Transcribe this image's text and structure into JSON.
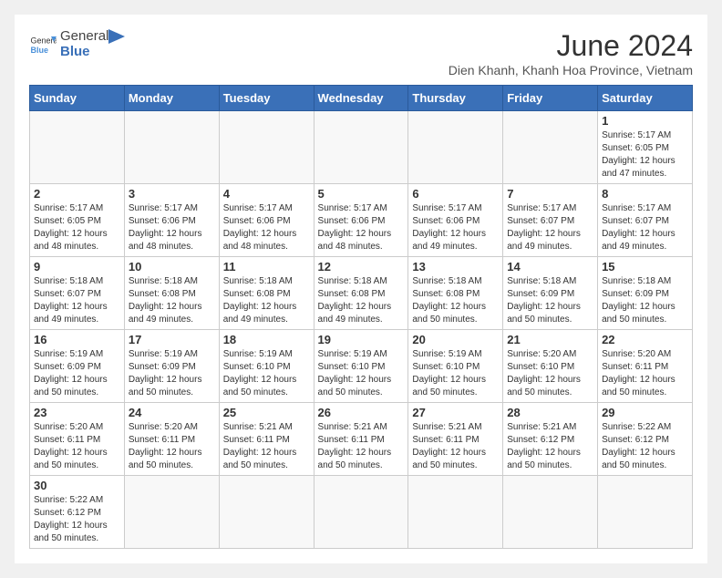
{
  "header": {
    "logo_general": "General",
    "logo_blue": "Blue",
    "month_title": "June 2024",
    "subtitle": "Dien Khanh, Khanh Hoa Province, Vietnam"
  },
  "weekdays": [
    "Sunday",
    "Monday",
    "Tuesday",
    "Wednesday",
    "Thursday",
    "Friday",
    "Saturday"
  ],
  "weeks": [
    {
      "days": [
        {
          "num": "",
          "info": ""
        },
        {
          "num": "",
          "info": ""
        },
        {
          "num": "",
          "info": ""
        },
        {
          "num": "",
          "info": ""
        },
        {
          "num": "",
          "info": ""
        },
        {
          "num": "",
          "info": ""
        },
        {
          "num": "1",
          "info": "Sunrise: 5:17 AM\nSunset: 6:05 PM\nDaylight: 12 hours and 47 minutes."
        }
      ]
    },
    {
      "days": [
        {
          "num": "2",
          "info": "Sunrise: 5:17 AM\nSunset: 6:05 PM\nDaylight: 12 hours and 48 minutes."
        },
        {
          "num": "3",
          "info": "Sunrise: 5:17 AM\nSunset: 6:06 PM\nDaylight: 12 hours and 48 minutes."
        },
        {
          "num": "4",
          "info": "Sunrise: 5:17 AM\nSunset: 6:06 PM\nDaylight: 12 hours and 48 minutes."
        },
        {
          "num": "5",
          "info": "Sunrise: 5:17 AM\nSunset: 6:06 PM\nDaylight: 12 hours and 48 minutes."
        },
        {
          "num": "6",
          "info": "Sunrise: 5:17 AM\nSunset: 6:06 PM\nDaylight: 12 hours and 49 minutes."
        },
        {
          "num": "7",
          "info": "Sunrise: 5:17 AM\nSunset: 6:07 PM\nDaylight: 12 hours and 49 minutes."
        },
        {
          "num": "8",
          "info": "Sunrise: 5:17 AM\nSunset: 6:07 PM\nDaylight: 12 hours and 49 minutes."
        }
      ]
    },
    {
      "days": [
        {
          "num": "9",
          "info": "Sunrise: 5:18 AM\nSunset: 6:07 PM\nDaylight: 12 hours and 49 minutes."
        },
        {
          "num": "10",
          "info": "Sunrise: 5:18 AM\nSunset: 6:08 PM\nDaylight: 12 hours and 49 minutes."
        },
        {
          "num": "11",
          "info": "Sunrise: 5:18 AM\nSunset: 6:08 PM\nDaylight: 12 hours and 49 minutes."
        },
        {
          "num": "12",
          "info": "Sunrise: 5:18 AM\nSunset: 6:08 PM\nDaylight: 12 hours and 49 minutes."
        },
        {
          "num": "13",
          "info": "Sunrise: 5:18 AM\nSunset: 6:08 PM\nDaylight: 12 hours and 50 minutes."
        },
        {
          "num": "14",
          "info": "Sunrise: 5:18 AM\nSunset: 6:09 PM\nDaylight: 12 hours and 50 minutes."
        },
        {
          "num": "15",
          "info": "Sunrise: 5:18 AM\nSunset: 6:09 PM\nDaylight: 12 hours and 50 minutes."
        }
      ]
    },
    {
      "days": [
        {
          "num": "16",
          "info": "Sunrise: 5:19 AM\nSunset: 6:09 PM\nDaylight: 12 hours and 50 minutes."
        },
        {
          "num": "17",
          "info": "Sunrise: 5:19 AM\nSunset: 6:09 PM\nDaylight: 12 hours and 50 minutes."
        },
        {
          "num": "18",
          "info": "Sunrise: 5:19 AM\nSunset: 6:10 PM\nDaylight: 12 hours and 50 minutes."
        },
        {
          "num": "19",
          "info": "Sunrise: 5:19 AM\nSunset: 6:10 PM\nDaylight: 12 hours and 50 minutes."
        },
        {
          "num": "20",
          "info": "Sunrise: 5:19 AM\nSunset: 6:10 PM\nDaylight: 12 hours and 50 minutes."
        },
        {
          "num": "21",
          "info": "Sunrise: 5:20 AM\nSunset: 6:10 PM\nDaylight: 12 hours and 50 minutes."
        },
        {
          "num": "22",
          "info": "Sunrise: 5:20 AM\nSunset: 6:11 PM\nDaylight: 12 hours and 50 minutes."
        }
      ]
    },
    {
      "days": [
        {
          "num": "23",
          "info": "Sunrise: 5:20 AM\nSunset: 6:11 PM\nDaylight: 12 hours and 50 minutes."
        },
        {
          "num": "24",
          "info": "Sunrise: 5:20 AM\nSunset: 6:11 PM\nDaylight: 12 hours and 50 minutes."
        },
        {
          "num": "25",
          "info": "Sunrise: 5:21 AM\nSunset: 6:11 PM\nDaylight: 12 hours and 50 minutes."
        },
        {
          "num": "26",
          "info": "Sunrise: 5:21 AM\nSunset: 6:11 PM\nDaylight: 12 hours and 50 minutes."
        },
        {
          "num": "27",
          "info": "Sunrise: 5:21 AM\nSunset: 6:11 PM\nDaylight: 12 hours and 50 minutes."
        },
        {
          "num": "28",
          "info": "Sunrise: 5:21 AM\nSunset: 6:12 PM\nDaylight: 12 hours and 50 minutes."
        },
        {
          "num": "29",
          "info": "Sunrise: 5:22 AM\nSunset: 6:12 PM\nDaylight: 12 hours and 50 minutes."
        }
      ]
    },
    {
      "days": [
        {
          "num": "30",
          "info": "Sunrise: 5:22 AM\nSunset: 6:12 PM\nDaylight: 12 hours and 50 minutes."
        },
        {
          "num": "",
          "info": ""
        },
        {
          "num": "",
          "info": ""
        },
        {
          "num": "",
          "info": ""
        },
        {
          "num": "",
          "info": ""
        },
        {
          "num": "",
          "info": ""
        },
        {
          "num": "",
          "info": ""
        }
      ]
    }
  ]
}
